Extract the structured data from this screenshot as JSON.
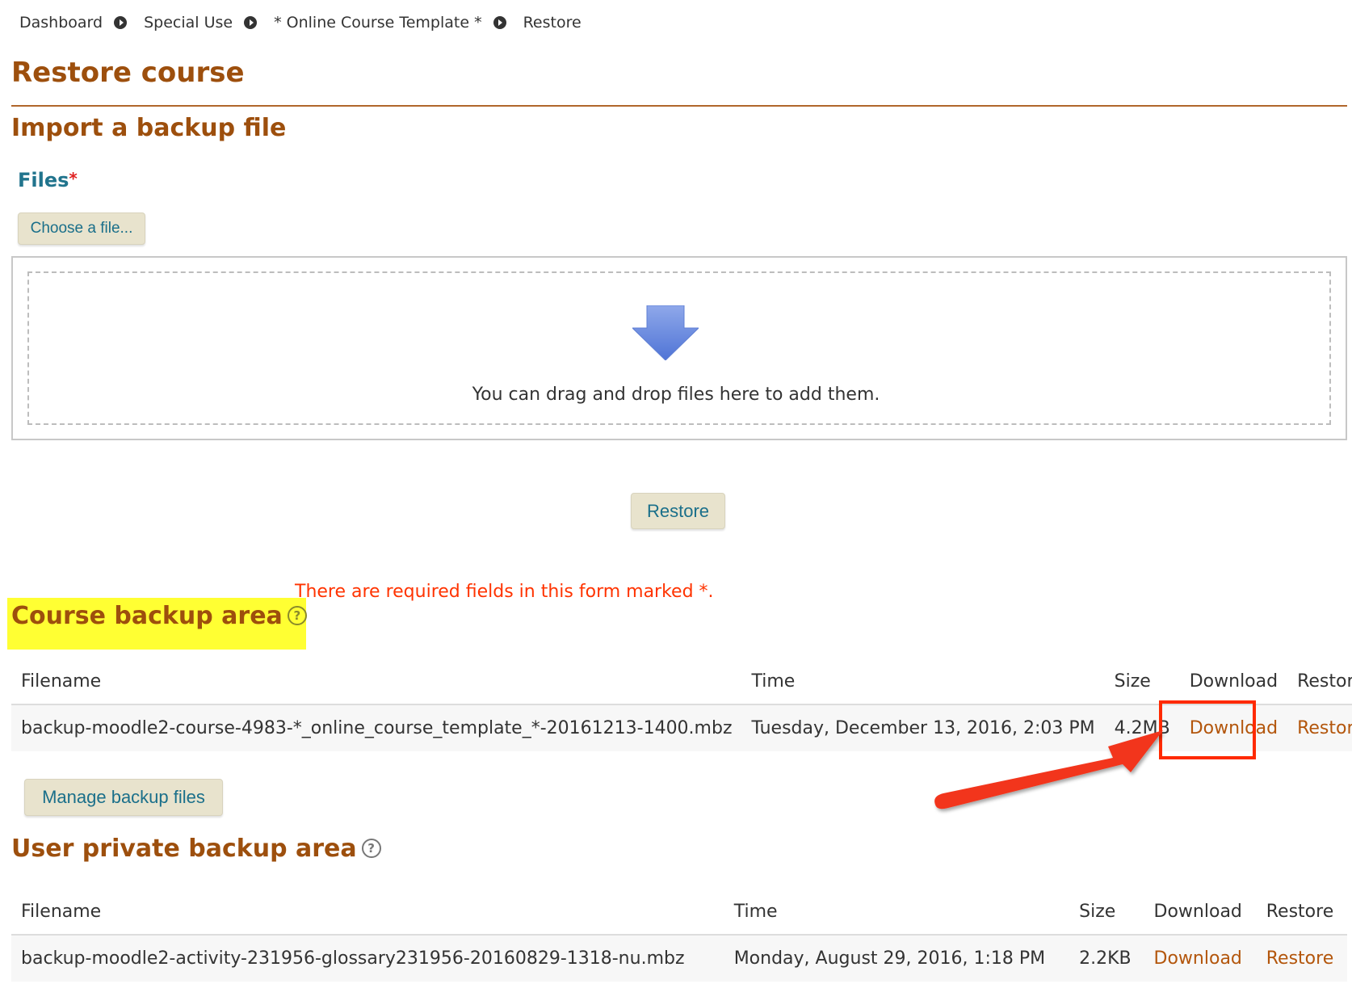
{
  "breadcrumb": [
    "Dashboard",
    "Special Use",
    "* Online Course Template *",
    "Restore"
  ],
  "page_title": "Restore course",
  "import_section": {
    "heading": "Import a backup file",
    "files_label": "Files",
    "required_marker": "*",
    "choose_button": "Choose a file...",
    "drop_text": "You can drag and drop files here to add them.",
    "restore_button": "Restore",
    "required_note": "There are required fields in this form marked *."
  },
  "course_backup": {
    "heading": "Course backup area",
    "columns": [
      "Filename",
      "Time",
      "Size",
      "Download",
      "Restore"
    ],
    "rows": [
      {
        "filename": "backup-moodle2-course-4983-*_online_course_template_*-20161213-1400.mbz",
        "time": "Tuesday, December 13, 2016, 2:03 PM",
        "size": "4.2MB",
        "download": "Download",
        "restore": "Restore"
      }
    ],
    "manage_button": "Manage backup files"
  },
  "user_backup": {
    "heading": "User private backup area",
    "columns": [
      "Filename",
      "Time",
      "Size",
      "Download",
      "Restore"
    ],
    "rows": [
      {
        "filename": "backup-moodle2-activity-231956-glossary231956-20160829-1318-nu.mbz",
        "time": "Monday, August 29, 2016, 1:18 PM",
        "size": "2.2KB",
        "download": "Download",
        "restore": "Restore"
      }
    ]
  },
  "colors": {
    "heading": "#9d4f0d",
    "link": "#b3560c",
    "label": "#21748d",
    "highlight": "#ffff33",
    "annotation": "#ff2a00",
    "required_note": "#ff3300"
  },
  "icons": {
    "breadcrumb_separator": "chevron-right-circle-icon",
    "drop_arrow": "arrow-down-icon",
    "help": "help-question-icon",
    "annotation": "red-arrow-annotation"
  }
}
